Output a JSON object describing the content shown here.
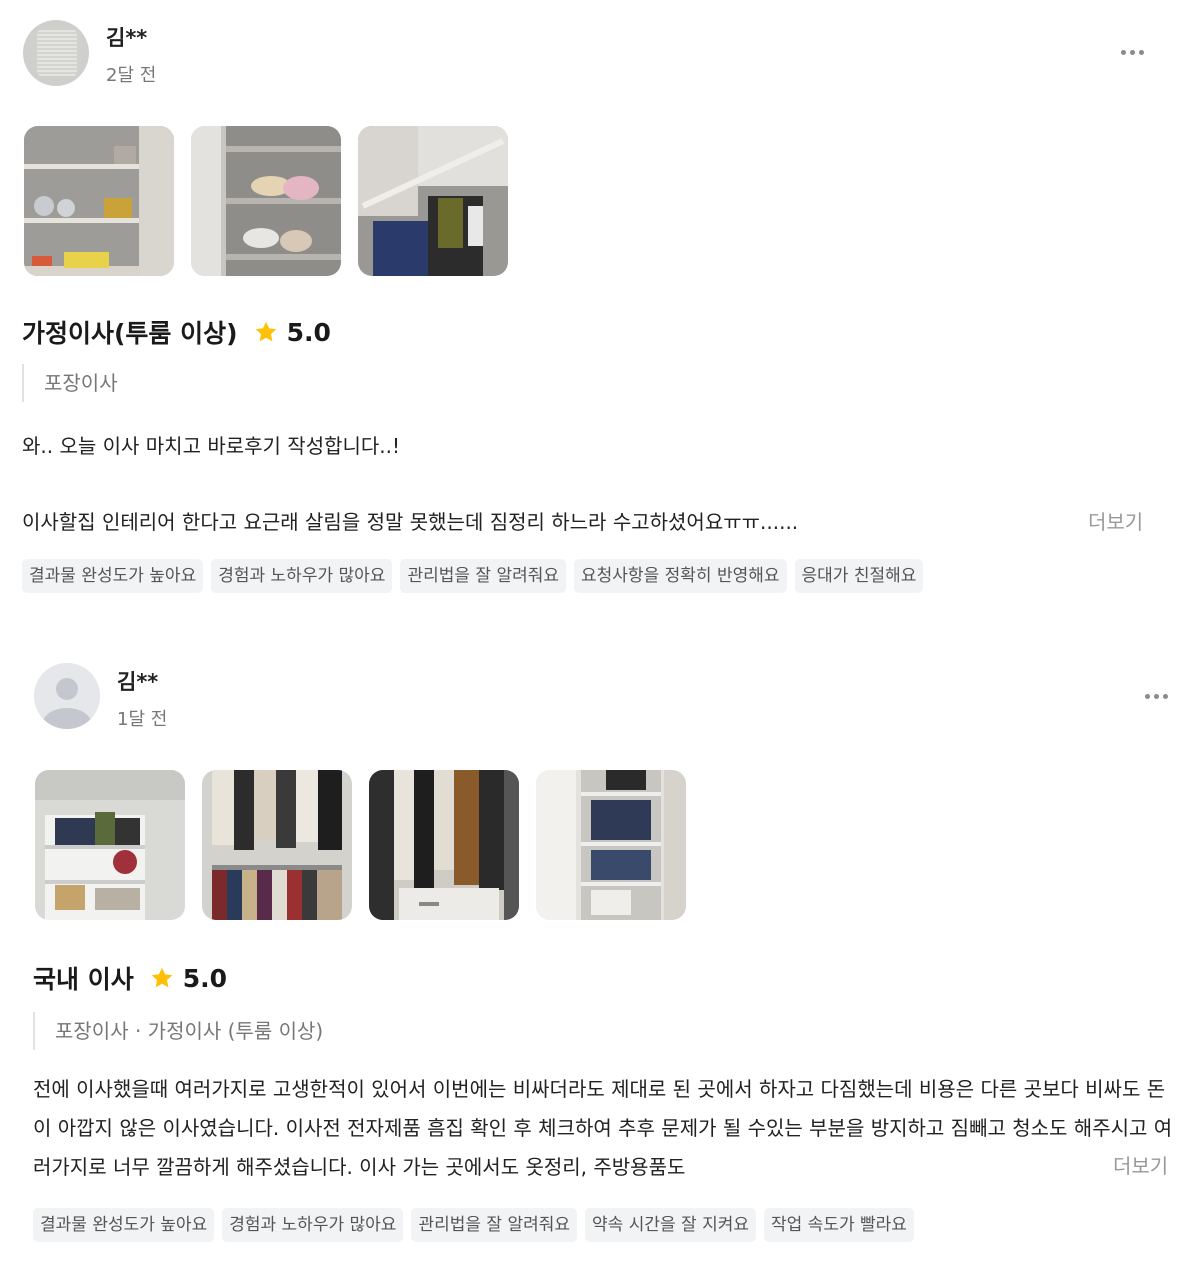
{
  "reviews": [
    {
      "author": "김**",
      "date": "2달 전",
      "title": "가정이사(투룸 이상)",
      "rating": "5.0",
      "category": "포장이사",
      "line1": "와.. 오늘 이사 마치고 바로후기 작성합니다..!",
      "line2": "이사할집 인테리어 한다고 요근래 살림을 정말 못했는데 짐정리 하느라 수고하셨어요ㅠㅠ......",
      "more_label": "더보기",
      "tags": [
        "결과물 완성도가 높아요",
        "경험과 노하우가 많아요",
        "관리법을 잘 알려줘요",
        "요청사항을 정확히 반영해요",
        "응대가 친절해요"
      ]
    },
    {
      "author": "김**",
      "date": "1달 전",
      "title": "국내 이사",
      "rating": "5.0",
      "category": "포장이사 · 가정이사 (투룸 이상)",
      "text": "전에 이사했을때 여러가지로 고생한적이 있어서 이번에는 비싸더라도 제대로 된 곳에서 하자고 다짐했는데 비용은 다른 곳보다 비싸도 돈이 아깝지 않은 이사였습니다. 이사전 전자제품 흠집 확인 후 체크하여 추후 문제가 될 수있는 부분을 방지하고 짐빼고 청소도 해주시고 여러가지로 너무 깔끔하게 해주셨습니다. 이사 가는 곳에서도 옷정리, 주방용품도",
      "more_label": "더보기",
      "tags": [
        "결과물 완성도가 높아요",
        "경험과 노하우가 많아요",
        "관리법을 잘 알려줘요",
        "약속 시간을 잘 지켜요",
        "작업 속도가 빨라요"
      ]
    }
  ],
  "colors": {
    "star": "#FFC107",
    "tag_bg": "#f2f3f5",
    "muted": "#777777"
  },
  "icons": {
    "more": "more-dots-icon",
    "star": "star-icon"
  }
}
